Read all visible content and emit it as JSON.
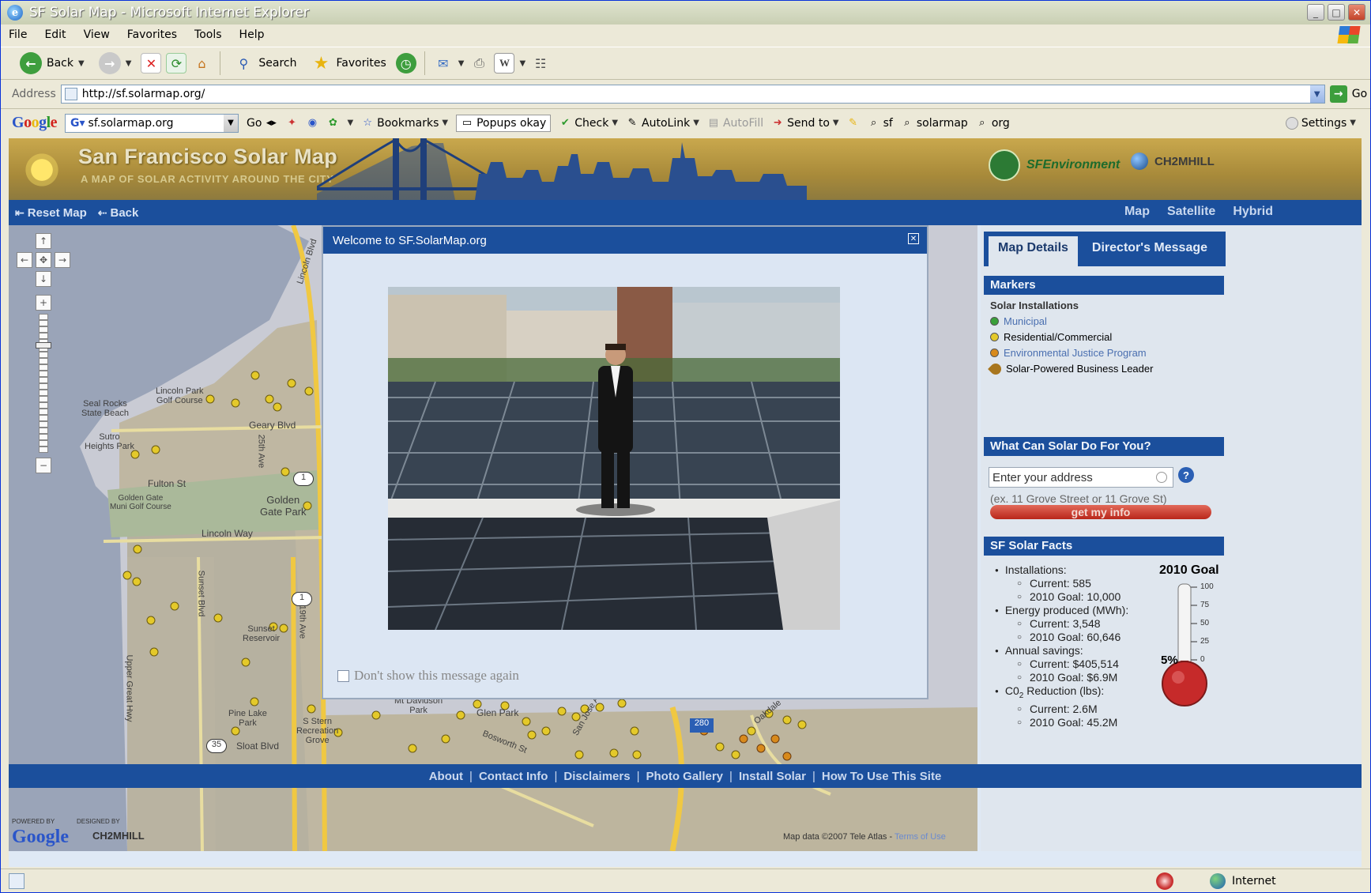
{
  "window": {
    "title": "SF Solar Map - Microsoft Internet Explorer"
  },
  "menu": [
    "File",
    "Edit",
    "View",
    "Favorites",
    "Tools",
    "Help"
  ],
  "toolbar": {
    "back": "Back",
    "search": "Search",
    "favorites": "Favorites"
  },
  "address": {
    "label": "Address",
    "url": "http://sf.solarmap.org/",
    "go": "Go"
  },
  "googlebar": {
    "query": "sf.solarmap.org",
    "go": "Go",
    "bookmarks": "Bookmarks",
    "popups": "Popups okay",
    "check": "Check",
    "autolink": "AutoLink",
    "autofill": "AutoFill",
    "sendto": "Send to",
    "terms": [
      "sf",
      "solarmap",
      "org"
    ],
    "settings": "Settings"
  },
  "site": {
    "title": "San Francisco Solar Map",
    "subtitle": "A MAP OF SOLAR ACTIVITY AROUND THE CITY",
    "partner1": "SFEnvironment",
    "partner2": "CH2MHILL",
    "nav": {
      "reset": "Reset Map",
      "back": "Back"
    },
    "map_types": [
      "Map",
      "Satellite",
      "Hybrid"
    ]
  },
  "map": {
    "labels": {
      "lincoln_blvd": "Lincoln Blvd",
      "lincoln_park": "Lincoln Park\nGolf Course",
      "seal_rocks": "Seal Rocks\nState Beach",
      "sutro": "Sutro\nHeights Park",
      "geary": "Geary Blvd",
      "ave25": "25th Ave",
      "fulton": "Fulton St",
      "golden_gate_park": "Golden\nGate Park",
      "golden_gate_golf": "Golden Gate\nMuni Golf Course",
      "lincoln_way": "Lincoln Way",
      "sunset_blvd": "Sunset Blvd",
      "ave19": "19th Ave",
      "sunset_res": "Sunset\nReservoir",
      "upper_great": "Upper Great Hwy",
      "pine_lake": "Pine Lake\nPark",
      "stern_grove": "S Stern\nRecreation\nGrove",
      "sloat": "Sloat Blvd",
      "mt_davidson": "Mt Davidson\nPark",
      "glen_park": "Glen Park",
      "bosworth": "Bosworth St",
      "san_jose": "San Jose Ave",
      "oakdale": "Oakdale",
      "hw1a": "1",
      "hw1b": "1",
      "hw35": "35",
      "hw280": "280"
    },
    "powered_by": "POWERED BY",
    "designed_by": "DESIGNED BY",
    "powered_logo": "Google",
    "designed_logo": "CH2MHILL",
    "copyright": "Map data ©2007 Tele Atlas -",
    "terms": "Terms of Use"
  },
  "modal": {
    "title": "Welcome to SF.SolarMap.org",
    "checkbox": "Don't show this message again"
  },
  "sidebar": {
    "tabs": [
      "Map Details",
      "Director's Message"
    ],
    "markers_head": "Markers",
    "installs_head": "Solar Installations",
    "legend": [
      {
        "label": "Municipal",
        "color": "#3aa03a"
      },
      {
        "label": "Residential/Commercial",
        "color": "#e4c92a"
      },
      {
        "label": "Environmental Justice Program",
        "color": "#d88a1c"
      },
      {
        "label": "Solar-Powered Business Leader",
        "color": "#a8761e"
      }
    ],
    "solar_head": "What Can Solar Do For You?",
    "address_placeholder": "Enter your address",
    "address_example": "(ex. 11 Grove Street or 11 Grove St)",
    "get_info": "get my info",
    "facts_head": "SF Solar Facts",
    "facts": {
      "installations": "Installations:",
      "inst_current": "Current: 585",
      "inst_goal": "2010 Goal: 10,000",
      "energy": "Energy produced (MWh):",
      "energy_current": "Current: 3,548",
      "energy_goal": "2010 Goal: 60,646",
      "savings": "Annual savings:",
      "savings_current": "Current: $405,514",
      "savings_goal": "2010 Goal: $6.9M",
      "co2_a": "C0",
      "co2_sub": "2",
      "co2_b": " Reduction (lbs):",
      "co2_current": "Current: 2.6M",
      "co2_goal": "2010 Goal: 45.2M"
    },
    "gauge": {
      "title": "2010 Goal",
      "percent_label": "5%",
      "percent": 5,
      "ticks": [
        "100",
        "75",
        "50",
        "25",
        "0"
      ]
    }
  },
  "footer": [
    "About",
    "Contact Info",
    "Disclaimers",
    "Photo Gallery",
    "Install Solar",
    "How To Use This Site"
  ],
  "status": {
    "zone": "Internet"
  },
  "colors": {
    "nav_blue": "#1b4f9c",
    "header_gold": "#b09443",
    "panel_bg": "#dfe6ee"
  }
}
